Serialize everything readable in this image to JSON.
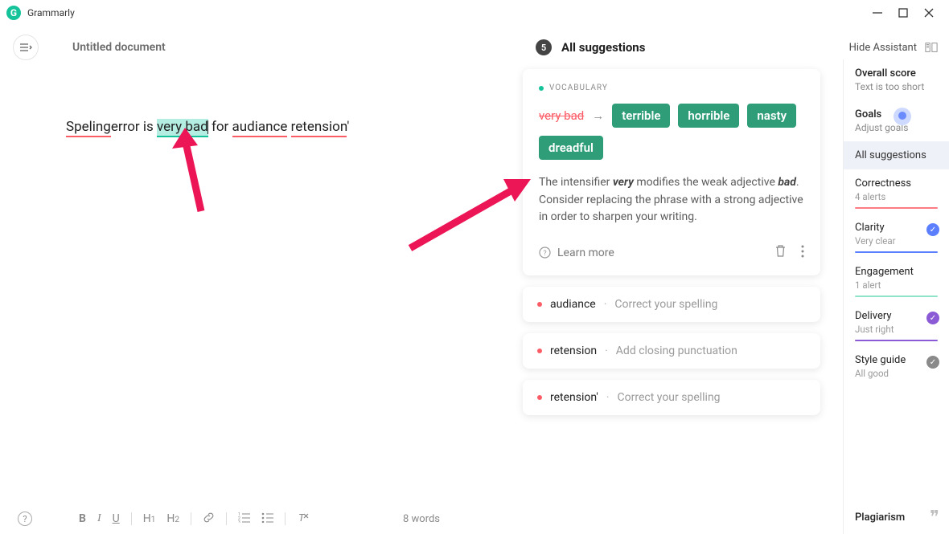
{
  "app": {
    "name": "Grammarly"
  },
  "doc": {
    "title": "Untitled document"
  },
  "panel": {
    "count": "5",
    "title": "All suggestions"
  },
  "assistant": {
    "hide_label": "Hide Assistant"
  },
  "editor": {
    "w1": "Speling",
    "w2": "error is ",
    "w3": "very bad",
    "w4": " for ",
    "w5": "audiance",
    "sp": " ",
    "w6": "retension",
    "w7": "'"
  },
  "expanded": {
    "tag": "VOCABULARY",
    "original": "very bad",
    "chips": [
      "terrible",
      "horrible",
      "nasty",
      "dreadful"
    ],
    "explain_pre": "The intensifier ",
    "explain_em1": "very",
    "explain_mid": " modifies the weak adjective ",
    "explain_em2": "bad",
    "explain_post": ". Consider replacing the phrase with a strong adjective in order to sharpen your writing.",
    "learn_more": "Learn more"
  },
  "collapsed": [
    {
      "word": "audiance",
      "hint": "Correct your spelling"
    },
    {
      "word": "retension",
      "hint": "Add closing punctuation"
    },
    {
      "word": "retension'",
      "hint": "Correct your spelling"
    }
  ],
  "sidebar": {
    "score_title": "Overall score",
    "score_sub": "Text is too short",
    "goals_title": "Goals",
    "goals_sub": "Adjust goals",
    "all_tab": "All suggestions",
    "cats": [
      {
        "title": "Correctness",
        "sub": "4 alerts",
        "bar": "#fc7b84",
        "check": null
      },
      {
        "title": "Clarity",
        "sub": "Very clear",
        "bar": "#5b7fff",
        "check": "#5b7fff"
      },
      {
        "title": "Engagement",
        "sub": "1 alert",
        "bar": "#8fe3c8",
        "check": null
      },
      {
        "title": "Delivery",
        "sub": "Just right",
        "bar": "#8b5bd6",
        "check": "#8b5bd6"
      },
      {
        "title": "Style guide",
        "sub": "All good",
        "bar": "transparent",
        "check": "#8a8a8a"
      }
    ],
    "plagiarism": "Plagiarism"
  },
  "bottom": {
    "word_count": "8 words"
  }
}
